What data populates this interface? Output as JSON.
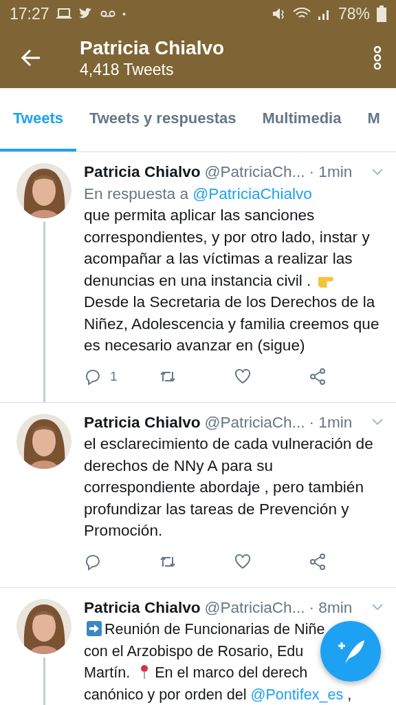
{
  "status_bar": {
    "time": "17:27",
    "battery": "78%"
  },
  "header": {
    "title": "Patricia Chialvo",
    "subtitle": "4,418 Tweets"
  },
  "tabs": [
    {
      "label": "Tweets",
      "selected": true
    },
    {
      "label": "Tweets y respuestas",
      "selected": false
    },
    {
      "label": "Multimedia",
      "selected": false
    },
    {
      "label": "M",
      "selected": false
    }
  ],
  "tweets": [
    {
      "name": "Patricia Chialvo",
      "handle": "@PatriciaCh...",
      "time": "· 1min",
      "reply_prefix": "En respuesta a",
      "reply_to": "@PatriciaChialvo",
      "body": [
        {
          "kind": "text",
          "text": "que permita aplicar las sanciones correspondientes, y por otro lado, instar y acompañar a las víctimas a realizar las denuncias en una instancia civil ."
        },
        {
          "kind": "hand"
        },
        {
          "kind": "text",
          "text": "Desde la Secretaria de los Derechos de la Niñez, Adolescencia y familia creemos que es necesario avanzar en (sigue)"
        }
      ],
      "replies": "1",
      "thread": true
    },
    {
      "name": "Patricia Chialvo",
      "handle": "@PatriciaCh...",
      "time": "· 1min",
      "body": [
        {
          "kind": "text",
          "text": "el esclarecimiento de cada vulneración de derechos de NNy A para su correspondiente abordaje , pero también profundizar las tareas de Prevención y Promoción."
        }
      ],
      "thread": false
    },
    {
      "name": "Patricia Chialvo",
      "handle": "@PatriciaCh...",
      "time": "· 8min",
      "lines": [
        [
          {
            "kind": "arrow"
          },
          {
            "kind": "text",
            "text": "Reunión de Funcionarias de Niñe"
          }
        ],
        [
          {
            "kind": "text",
            "text": "con el Arzobispo de Rosario, Edu"
          }
        ],
        [
          {
            "kind": "text",
            "text": "Martín."
          },
          {
            "kind": "pin"
          },
          {
            "kind": "text",
            "text": "En el marco del derech"
          }
        ],
        [
          {
            "kind": "text",
            "text": "canónico y por orden del"
          },
          {
            "kind": "mention",
            "text": "@Pontifex_es"
          },
          {
            "kind": "text",
            "text": ","
          }
        ]
      ],
      "thread": true
    }
  ]
}
